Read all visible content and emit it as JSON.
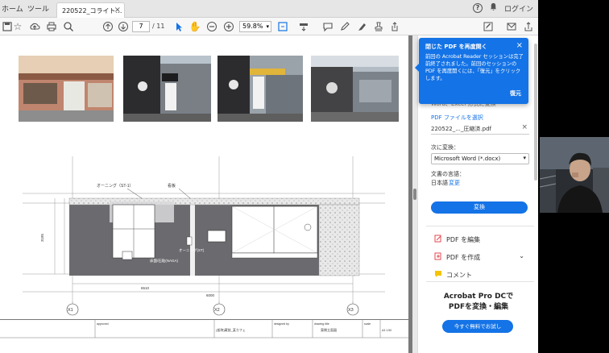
{
  "app": {
    "nav": {
      "home": "ホーム",
      "tools": "ツール"
    },
    "tab_title": "220522_コライト…",
    "right": {
      "help": "?",
      "login": "ログイン"
    }
  },
  "toolbar": {
    "page_current": "7",
    "page_total": "/ 11",
    "zoom": "59.8%"
  },
  "panel": {
    "hidden_header": "ファイルを...",
    "hint": "Word、Excel 形式に変換",
    "pdf_select_label": "PDF ファイルを選択",
    "file_name": "220522_..._圧縮済.pdf",
    "convert_to_label": "次に変換：",
    "format_value": "Microsoft Word (*.docx)",
    "doc_lang_label": "文書の言語：",
    "doc_lang_value": "日本語",
    "doc_lang_change": "変更",
    "convert_button": "変換",
    "tools": [
      {
        "label": "PDF を編集"
      },
      {
        "label": "PDF を作成"
      },
      {
        "label": "コメント"
      }
    ],
    "promo_line1": "Acrobat Pro DCで",
    "promo_line2": "PDFを変換・編集",
    "promo_button": "今すぐ無料でお試し"
  },
  "popup": {
    "title": "閉じた PDF を再度開く",
    "body": "前回の Acrobat Reader セッションは完了前終了されました。前回のセッションのPDF を再度開くには、「復元」をクリックします。",
    "restore": "復元"
  },
  "drawing": {
    "label_awning": "オーニング（ST-1）",
    "label_sign": "看板",
    "label_awning2": "オーニング(ST)",
    "label_stone": "床面/石貼(NAGA)",
    "label_x1": "X1",
    "label_x2": "X2",
    "label_x3": "X3",
    "dim_6510": "6510",
    "dim_6000": "6000",
    "dim_3185": "3185",
    "title_stamp": "東側立面図",
    "title_block": [
      "approved",
      "designed by",
      "drawing title",
      "scale"
    ],
    "title_block_values": [
      "(仮称)蔵前_某カフェ",
      "東側立面図",
      "A3 1:50"
    ]
  },
  "colors": {
    "accent": "#1473e6",
    "wall": "#6b6b6f",
    "stone": "#cfcfcf"
  }
}
